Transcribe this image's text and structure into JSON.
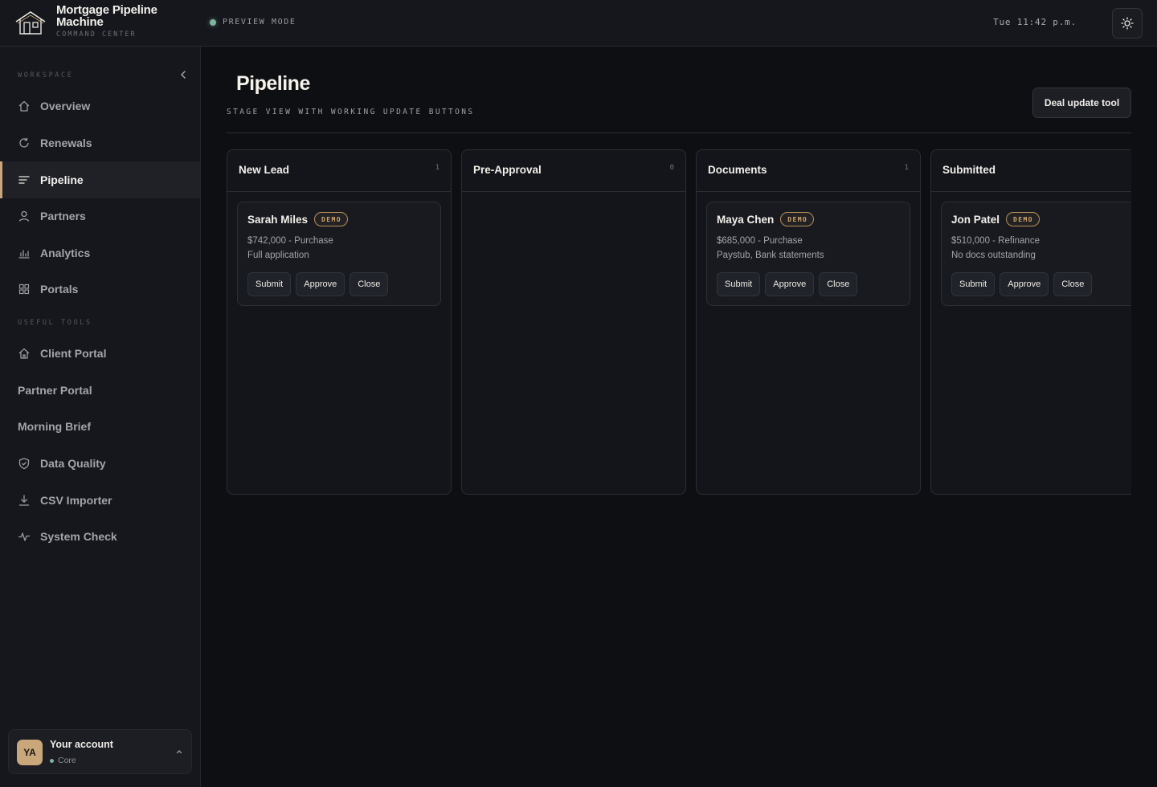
{
  "app": {
    "title": "Mortgage Pipeline Machine",
    "subtitle": "COMMAND CENTER",
    "mode": "PREVIEW MODE",
    "clock": "Tue 11:42 p.m."
  },
  "sidebar": {
    "workspace_label": "WORKSPACE",
    "tools_label": "USEFUL TOOLS",
    "workspace_items": [
      {
        "label": "Overview",
        "icon": "home-icon"
      },
      {
        "label": "Renewals",
        "icon": "refresh-icon"
      },
      {
        "label": "Pipeline",
        "icon": "list-icon",
        "active": true
      },
      {
        "label": "Partners",
        "icon": "user-icon"
      },
      {
        "label": "Analytics",
        "icon": "bar-chart-icon"
      },
      {
        "label": "Portals",
        "icon": "grid-icon"
      }
    ],
    "tool_items": [
      {
        "label": "Client Portal",
        "icon": "home-icon"
      },
      {
        "label": "Partner Portal"
      },
      {
        "label": "Morning Brief"
      },
      {
        "label": "Data Quality",
        "icon": "shield-icon"
      },
      {
        "label": "CSV Importer",
        "icon": "download-icon"
      },
      {
        "label": "System Check",
        "icon": "activity-icon"
      }
    ],
    "account": {
      "initials": "YA",
      "name": "Your account",
      "plan": "Core"
    }
  },
  "main": {
    "title": "Pipeline",
    "subtitle": "STAGE VIEW WITH WORKING UPDATE BUTTONS",
    "deal_button": "Deal update tool",
    "columns": [
      {
        "title": "New Lead",
        "count": "1",
        "cards": [
          {
            "name": "Sarah Miles",
            "badge": "DEMO",
            "line1": "$742,000 - Purchase",
            "line2": "Full application",
            "actions": [
              "Submit",
              "Approve",
              "Close"
            ]
          }
        ]
      },
      {
        "title": "Pre-Approval",
        "count": "0",
        "cards": []
      },
      {
        "title": "Documents",
        "count": "1",
        "cards": [
          {
            "name": "Maya Chen",
            "badge": "DEMO",
            "line1": "$685,000 - Purchase",
            "line2": "Paystub, Bank statements",
            "actions": [
              "Submit",
              "Approve",
              "Close"
            ]
          }
        ]
      },
      {
        "title": "Submitted",
        "count": "",
        "cards": [
          {
            "name": "Jon Patel",
            "badge": "DEMO",
            "line1": "$510,000 - Refinance",
            "line2": "No docs outstanding",
            "actions": [
              "Submit",
              "Approve",
              "Close"
            ]
          }
        ]
      }
    ]
  },
  "colors": {
    "accent": "#c9a77a",
    "status_dot": "#7fb59d",
    "background": "#0e0f13",
    "panel": "#15171c"
  }
}
